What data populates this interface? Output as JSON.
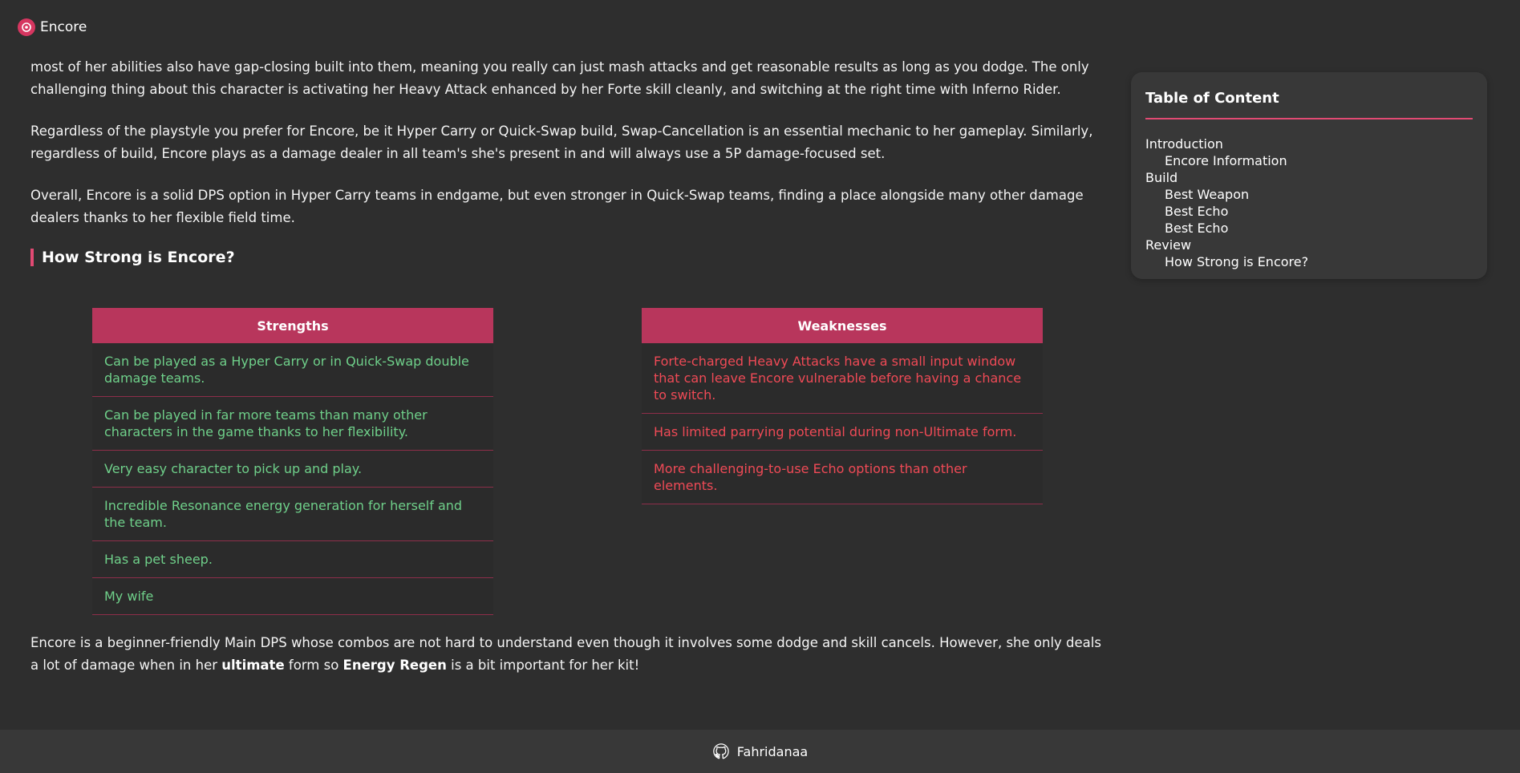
{
  "app": {
    "name": "Encore",
    "logo_icon": "encore-logo-icon",
    "accent": "#e14a73"
  },
  "article": {
    "paragraphs": [
      "most of her abilities also have gap-closing built into them, meaning you really can just mash attacks and get reasonable results as long as you dodge. The only challenging thing about this character is activating her Heavy Attack enhanced by her Forte skill cleanly, and switching at the right time with Inferno Rider.",
      "Regardless of the playstyle you prefer for Encore, be it Hyper Carry or Quick-Swap build, Swap-Cancellation is an essential mechanic to her gameplay. Similarly, regardless of build, Encore plays as a damage dealer in all team's she's present in and will always use a 5P damage-focused set.",
      "Overall, Encore is a solid DPS option in Hyper Carry teams in endgame, but even stronger in Quick-Swap teams, finding a place alongside many other damage dealers thanks to her flexible field time."
    ],
    "section_title": "How Strong is Encore?",
    "strengths": {
      "header": "Strengths",
      "color": "#6fd08a",
      "items": [
        "Can be played as a Hyper Carry or in Quick-Swap double damage teams.",
        "Can be played in far more teams than many other characters in the game thanks to her flexibility.",
        "Very easy character to pick up and play.",
        "Incredible Resonance energy generation for herself and the team.",
        "Has a pet sheep.",
        "My wife"
      ]
    },
    "weaknesses": {
      "header": "Weaknesses",
      "color": "#ef4a56",
      "items": [
        "Forte-charged Heavy Attacks have a small input window that can leave Encore vulnerable before having a chance to switch.",
        "Has limited parrying potential during non-Ultimate form.",
        "More challenging-to-use Echo options than other elements."
      ]
    },
    "closing": {
      "part1": "Encore is a beginner-friendly Main DPS whose combos are not hard to understand even though it involves some dodge and skill cancels. However, she only deals a lot of damage when in her ",
      "bold1": "ultimate",
      "part2": " form so ",
      "bold2": "Energy Regen",
      "part3": " is a bit important for her kit!"
    }
  },
  "toc": {
    "title": "Table of Content",
    "items": [
      {
        "label": "Introduction",
        "level": 1
      },
      {
        "label": "Encore Information",
        "level": 2
      },
      {
        "label": "Build",
        "level": 1
      },
      {
        "label": "Best Weapon",
        "level": 2
      },
      {
        "label": "Best Echo",
        "level": 2
      },
      {
        "label": "Best Echo",
        "level": 2
      },
      {
        "label": "Review",
        "level": 1
      },
      {
        "label": "How Strong is Encore?",
        "level": 2
      }
    ]
  },
  "footer": {
    "name": "Fahridanaa",
    "icon": "github-icon"
  }
}
